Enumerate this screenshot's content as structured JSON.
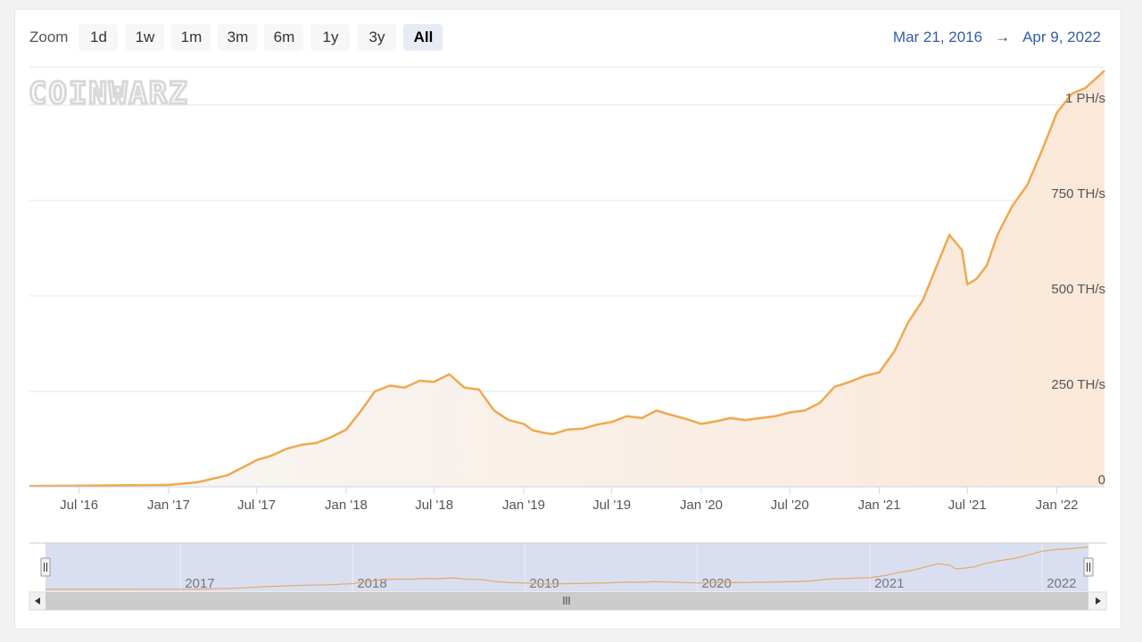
{
  "toolbar": {
    "zoom_label": "Zoom",
    "buttons": [
      "1d",
      "1w",
      "1m",
      "3m",
      "6m",
      "1y",
      "3y",
      "All"
    ],
    "active": "All"
  },
  "range": {
    "from": "Mar 21, 2016",
    "arrow": "→",
    "to": "Apr 9, 2022"
  },
  "watermark": "COINWARZ",
  "colors": {
    "line": "#f0a84e",
    "area_top": "#fbe8d8",
    "area_bottom": "#f7f7f7",
    "grid": "#e6e6e6",
    "navigator_mask": "#d2d9ee",
    "navigator_line": "#e8a869",
    "range_text": "#335cad"
  },
  "chart_data": {
    "type": "area",
    "title": "",
    "xlabel": "",
    "ylabel": "",
    "xlim": [
      "2016-03-21",
      "2022-04-09"
    ],
    "ylim": [
      0,
      1100
    ],
    "y_unit": "TH/s",
    "x_tick_labels": [
      {
        "date": "2016-07-01",
        "label": "Jul '16"
      },
      {
        "date": "2017-01-01",
        "label": "Jan '17"
      },
      {
        "date": "2017-07-01",
        "label": "Jul '17"
      },
      {
        "date": "2018-01-01",
        "label": "Jan '18"
      },
      {
        "date": "2018-07-01",
        "label": "Jul '18"
      },
      {
        "date": "2019-01-01",
        "label": "Jan '19"
      },
      {
        "date": "2019-07-01",
        "label": "Jul '19"
      },
      {
        "date": "2020-01-01",
        "label": "Jan '20"
      },
      {
        "date": "2020-07-01",
        "label": "Jul '20"
      },
      {
        "date": "2021-01-01",
        "label": "Jan '21"
      },
      {
        "date": "2021-07-01",
        "label": "Jul '21"
      },
      {
        "date": "2022-01-01",
        "label": "Jan '22"
      }
    ],
    "y_tick_labels": [
      {
        "value": 0,
        "label": "0"
      },
      {
        "value": 250,
        "label": "250 TH/s"
      },
      {
        "value": 500,
        "label": "500 TH/s"
      },
      {
        "value": 750,
        "label": "750 TH/s"
      },
      {
        "value": 1000,
        "label": "1 PH/s"
      }
    ],
    "navigator_labels": [
      {
        "date": "2017-01-01",
        "label": "2017"
      },
      {
        "date": "2018-01-01",
        "label": "2018"
      },
      {
        "date": "2019-01-01",
        "label": "2019"
      },
      {
        "date": "2020-01-01",
        "label": "2020"
      },
      {
        "date": "2021-01-01",
        "label": "2021"
      },
      {
        "date": "2022-01-01",
        "label": "2022"
      }
    ],
    "series": [
      {
        "name": "",
        "points": [
          [
            "2016-03-21",
            2
          ],
          [
            "2016-07-01",
            3
          ],
          [
            "2016-10-01",
            4
          ],
          [
            "2017-01-01",
            5
          ],
          [
            "2017-03-01",
            12
          ],
          [
            "2017-05-01",
            30
          ],
          [
            "2017-06-01",
            50
          ],
          [
            "2017-07-01",
            70
          ],
          [
            "2017-08-01",
            82
          ],
          [
            "2017-09-01",
            100
          ],
          [
            "2017-10-01",
            110
          ],
          [
            "2017-11-01",
            115
          ],
          [
            "2017-12-01",
            130
          ],
          [
            "2018-01-01",
            150
          ],
          [
            "2018-02-01",
            200
          ],
          [
            "2018-03-01",
            250
          ],
          [
            "2018-04-01",
            265
          ],
          [
            "2018-05-01",
            260
          ],
          [
            "2018-06-01",
            278
          ],
          [
            "2018-07-01",
            275
          ],
          [
            "2018-08-01",
            295
          ],
          [
            "2018-09-01",
            260
          ],
          [
            "2018-10-01",
            255
          ],
          [
            "2018-11-01",
            200
          ],
          [
            "2018-12-01",
            175
          ],
          [
            "2019-01-01",
            165
          ],
          [
            "2019-01-20",
            148
          ],
          [
            "2019-02-10",
            142
          ],
          [
            "2019-03-01",
            138
          ],
          [
            "2019-04-01",
            150
          ],
          [
            "2019-05-01",
            152
          ],
          [
            "2019-06-01",
            163
          ],
          [
            "2019-07-01",
            170
          ],
          [
            "2019-08-01",
            185
          ],
          [
            "2019-09-01",
            180
          ],
          [
            "2019-10-01",
            200
          ],
          [
            "2019-11-01",
            188
          ],
          [
            "2019-12-01",
            178
          ],
          [
            "2020-01-01",
            165
          ],
          [
            "2020-02-01",
            172
          ],
          [
            "2020-03-01",
            180
          ],
          [
            "2020-04-01",
            175
          ],
          [
            "2020-05-01",
            180
          ],
          [
            "2020-06-01",
            185
          ],
          [
            "2020-07-01",
            195
          ],
          [
            "2020-08-01",
            200
          ],
          [
            "2020-09-01",
            220
          ],
          [
            "2020-10-01",
            262
          ],
          [
            "2020-11-01",
            275
          ],
          [
            "2020-12-01",
            290
          ],
          [
            "2021-01-01",
            300
          ],
          [
            "2021-02-01",
            355
          ],
          [
            "2021-03-01",
            430
          ],
          [
            "2021-04-01",
            490
          ],
          [
            "2021-05-01",
            585
          ],
          [
            "2021-05-25",
            660
          ],
          [
            "2021-06-20",
            620
          ],
          [
            "2021-07-01",
            530
          ],
          [
            "2021-07-20",
            545
          ],
          [
            "2021-08-10",
            580
          ],
          [
            "2021-09-01",
            660
          ],
          [
            "2021-10-01",
            735
          ],
          [
            "2021-11-01",
            790
          ],
          [
            "2021-12-01",
            880
          ],
          [
            "2022-01-01",
            980
          ],
          [
            "2022-02-01",
            1030
          ],
          [
            "2022-03-01",
            1045
          ],
          [
            "2022-04-09",
            1090
          ]
        ]
      }
    ]
  }
}
